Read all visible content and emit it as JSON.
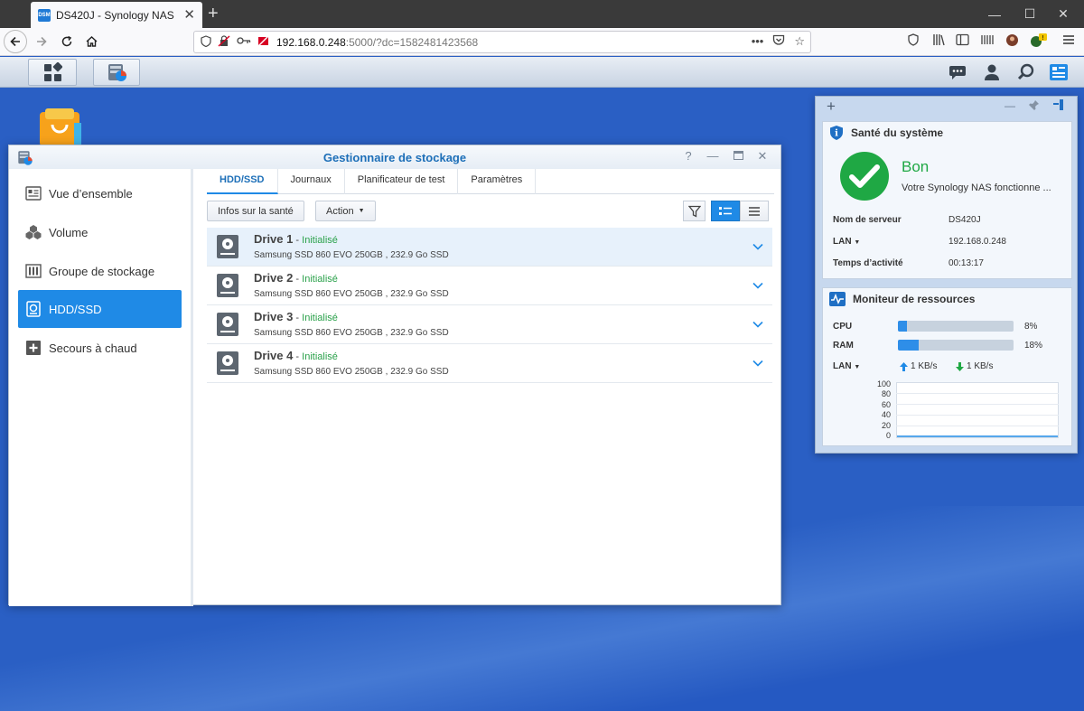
{
  "browser": {
    "tab_title": "DS420J - Synology NAS",
    "favicon_text": "DSM",
    "url_host": "192.168.0.248",
    "url_rest": ":5000/?dc=1582481423568",
    "icons": [
      "back-icon",
      "forward-icon",
      "reload-icon",
      "home-icon",
      "shield-icon",
      "lock-icon",
      "key-icon",
      "more-icon",
      "pocket-icon",
      "star-icon",
      "library-icon",
      "sidebar-icon",
      "extensions-icon",
      "menu-icon"
    ]
  },
  "window": {
    "title": "Gestionnaire de stockage"
  },
  "sidebar": {
    "items": [
      {
        "label": "Vue d’ensemble",
        "icon": "overview-icon"
      },
      {
        "label": "Volume",
        "icon": "volume-icon"
      },
      {
        "label": "Groupe de stockage",
        "icon": "storage-pool-icon"
      },
      {
        "label": "HDD/SSD",
        "icon": "disk-icon",
        "active": true
      },
      {
        "label": "Secours à chaud",
        "icon": "hot-spare-icon"
      }
    ]
  },
  "tabs": [
    "HDD/SSD",
    "Journaux",
    "Planificateur de test",
    "Paramètres"
  ],
  "toolbar": {
    "health_label": "Infos sur la santé",
    "action_label": "Action"
  },
  "drives": [
    {
      "name": "Drive 1",
      "status": "Initialisé",
      "desc": "Samsung SSD 860 EVO 250GB , 232.9 Go SSD"
    },
    {
      "name": "Drive 2",
      "status": "Initialisé",
      "desc": "Samsung SSD 860 EVO 250GB , 232.9 Go SSD"
    },
    {
      "name": "Drive 3",
      "status": "Initialisé",
      "desc": "Samsung SSD 860 EVO 250GB , 232.9 Go SSD"
    },
    {
      "name": "Drive 4",
      "status": "Initialisé",
      "desc": "Samsung SSD 860 EVO 250GB , 232.9 Go SSD"
    }
  ],
  "health": {
    "title": "Santé du système",
    "status": "Bon",
    "message": "Votre Synology NAS fonctionne ...",
    "rows": [
      {
        "key": "Nom de serveur",
        "value": "DS420J"
      },
      {
        "key": "LAN",
        "value": "192.168.0.248"
      },
      {
        "key": "Temps d’activité",
        "value": "00:13:17"
      }
    ]
  },
  "monitor": {
    "title": "Moniteur de ressources",
    "cpu_label": "CPU",
    "cpu_pct": 8,
    "cpu_text": "8%",
    "ram_label": "RAM",
    "ram_pct": 18,
    "ram_text": "18%",
    "lan_label": "LAN",
    "up": "1 KB/s",
    "down": "1 KB/s",
    "axis": [
      "100",
      "80",
      "60",
      "40",
      "20",
      "0"
    ]
  },
  "colors": {
    "accent": "#1f8ae6",
    "ok_green": "#1fa844",
    "status_green": "#2aa14a"
  }
}
